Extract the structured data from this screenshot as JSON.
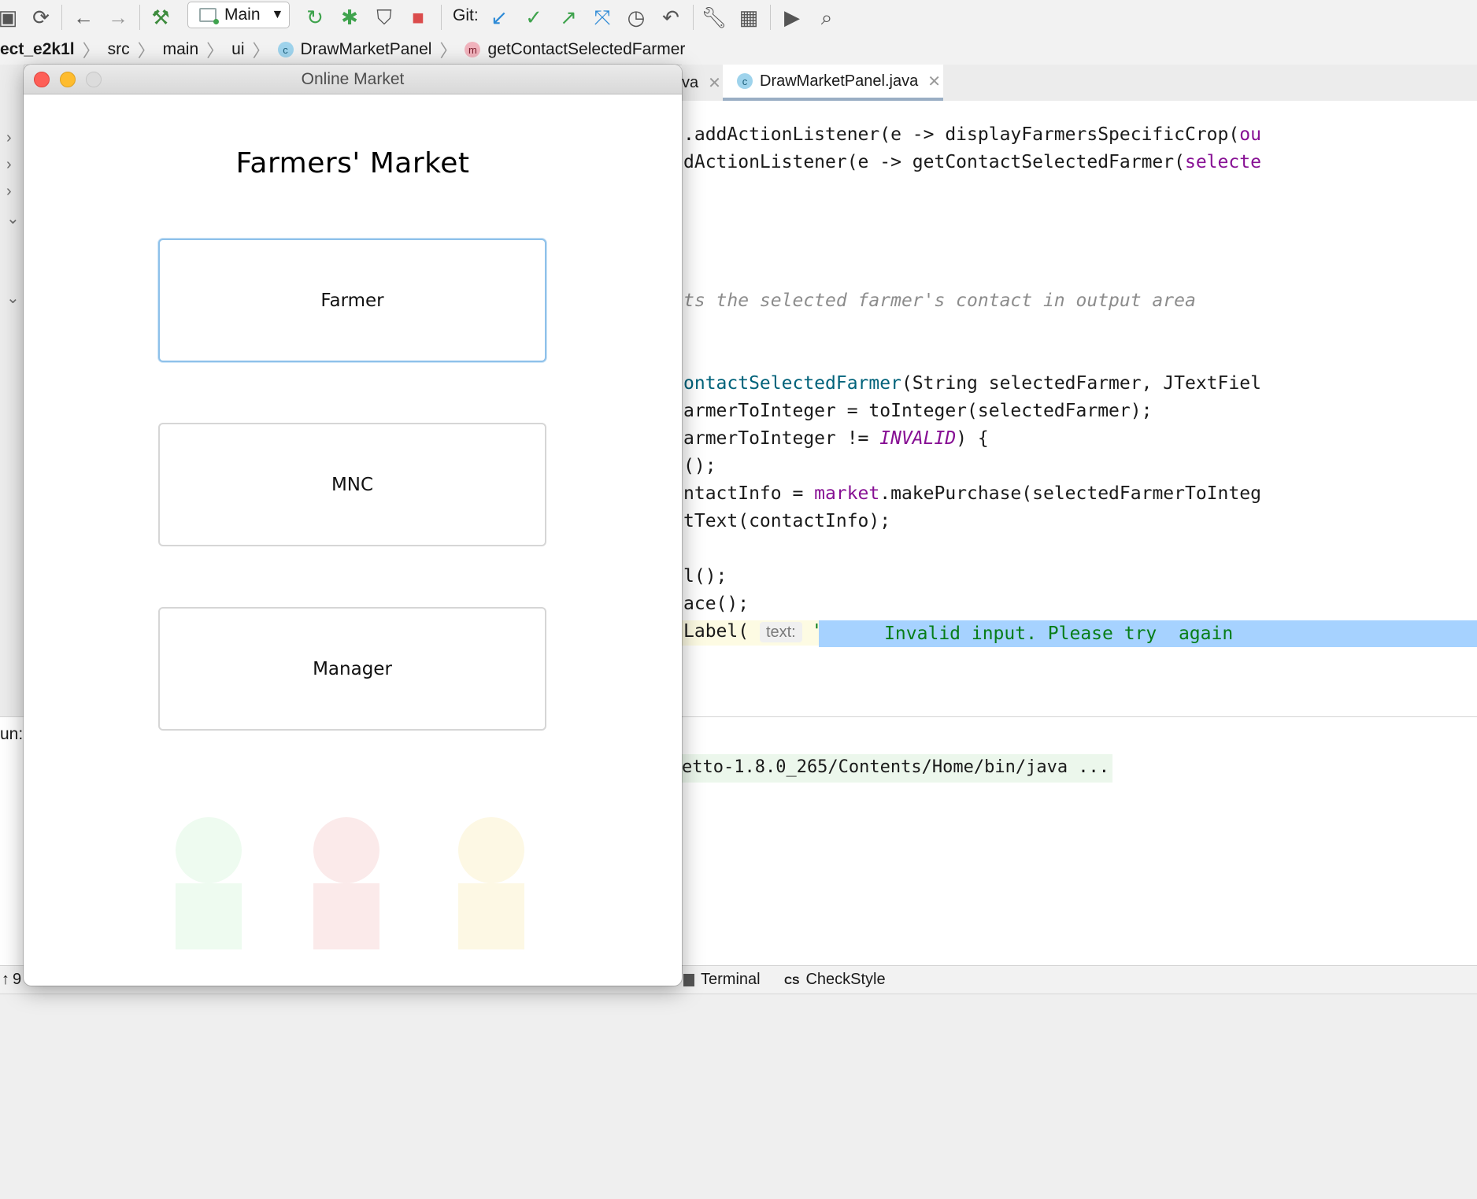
{
  "toolbar": {
    "run_config": "Main",
    "git_label": "Git:"
  },
  "breadcrumb": {
    "items": [
      "ect_e2k1l",
      "src",
      "main",
      "ui",
      "DrawMarketPanel",
      "getContactSelectedFarmer"
    ]
  },
  "editor_tabs": [
    {
      "label": "va"
    },
    {
      "label": "DrawMarketPanel.java"
    }
  ],
  "code": {
    "line1": ".addActionListener(e -> displayFarmersSpecificCrop(",
    "line1b": "ou",
    "line2": "dActionListener(e -> getContactSelectedFarmer(",
    "line2b": "selecte",
    "line3": "ts the selected farmer's contact in output area",
    "line4a": "ontactSelectedFarmer",
    "line4b": "(String selectedFarmer, JTextFiel",
    "line5": "armerToInteger = toInteger(selectedFarmer);",
    "line6a": "armerToInteger != ",
    "line6b": "INVALID",
    "line6c": ") {",
    "line7": "();",
    "line8a": "ntactInfo = ",
    "line8b": "market",
    "line8c": ".makePurchase(selectedFarmerToInteg",
    "line9": "tText(contactInfo);",
    "line10": "l();",
    "line11": "ace();",
    "line12a": "Label( ",
    "line12hint": "text:",
    "line12quote": " \"",
    "line12str": "      Invalid input. Please try  again"
  },
  "run": {
    "label": "un:",
    "output": "etto-1.8.0_265/Contents/Home/bin/java ..."
  },
  "bottom_bar": {
    "left_number": "9",
    "terminal": "Terminal",
    "checkstyle_icon": "CS",
    "checkstyle": "CheckStyle"
  },
  "window": {
    "title": "Online Market",
    "heading": "Farmers' Market",
    "buttons": [
      "Farmer",
      "MNC",
      "Manager"
    ],
    "figure_colors": [
      "#eefbf0",
      "#fbeaea",
      "#fdf8e4"
    ]
  }
}
